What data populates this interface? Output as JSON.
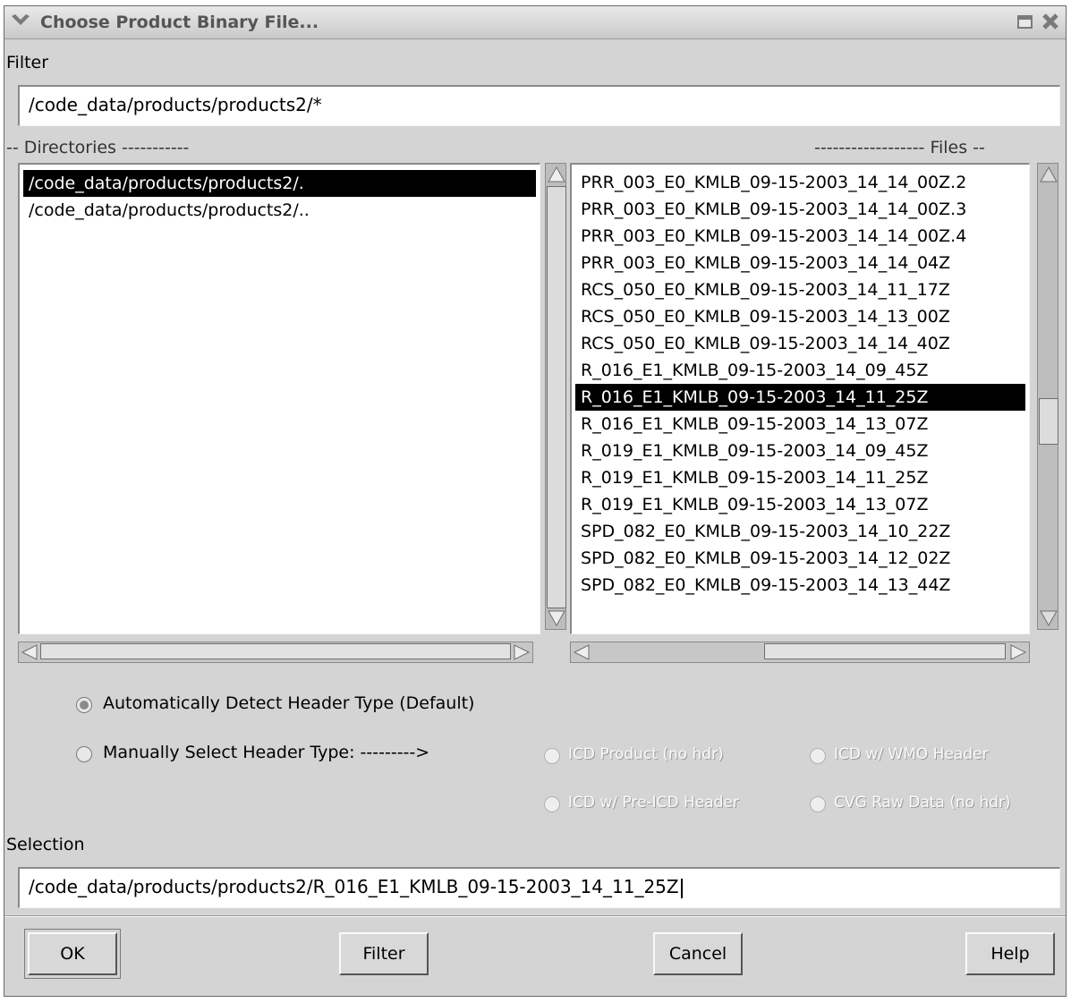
{
  "window": {
    "title": "Choose Product Binary File..."
  },
  "filter": {
    "label": "Filter",
    "value": "/code_data/products/products2/*"
  },
  "directories": {
    "label": "-- Directories -----------",
    "items": [
      "/code_data/products/products2/.",
      "/code_data/products/products2/.."
    ],
    "selected_index": 0
  },
  "files": {
    "label": "------------------ Files --",
    "items": [
      "PRR_003_E0_KMLB_09-15-2003_14_14_00Z.2",
      "PRR_003_E0_KMLB_09-15-2003_14_14_00Z.3",
      "PRR_003_E0_KMLB_09-15-2003_14_14_00Z.4",
      "PRR_003_E0_KMLB_09-15-2003_14_14_04Z",
      "RCS_050_E0_KMLB_09-15-2003_14_11_17Z",
      "RCS_050_E0_KMLB_09-15-2003_14_13_00Z",
      "RCS_050_E0_KMLB_09-15-2003_14_14_40Z",
      "R_016_E1_KMLB_09-15-2003_14_09_45Z",
      "R_016_E1_KMLB_09-15-2003_14_11_25Z",
      "R_016_E1_KMLB_09-15-2003_14_13_07Z",
      "R_019_E1_KMLB_09-15-2003_14_09_45Z",
      "R_019_E1_KMLB_09-15-2003_14_11_25Z",
      "R_019_E1_KMLB_09-15-2003_14_13_07Z",
      "SPD_082_E0_KMLB_09-15-2003_14_10_22Z",
      "SPD_082_E0_KMLB_09-15-2003_14_12_02Z",
      "SPD_082_E0_KMLB_09-15-2003_14_13_44Z"
    ],
    "selected_index": 8
  },
  "header_options": {
    "auto_detect": "Automatically Detect Header Type (Default)",
    "manual_select": "Manually Select Header Type: --------->",
    "icd_product": "ICD Product (no hdr)",
    "icd_wmo": "ICD w/ WMO Header",
    "icd_pre_icd": "ICD w/ Pre-ICD Header",
    "cvg_raw": "CVG Raw Data (no hdr)"
  },
  "selection": {
    "label": "Selection",
    "value": "/code_data/products/products2/R_016_E1_KMLB_09-15-2003_14_11_25Z"
  },
  "buttons": {
    "ok": "OK",
    "filter": "Filter",
    "cancel": "Cancel",
    "help": "Help"
  }
}
